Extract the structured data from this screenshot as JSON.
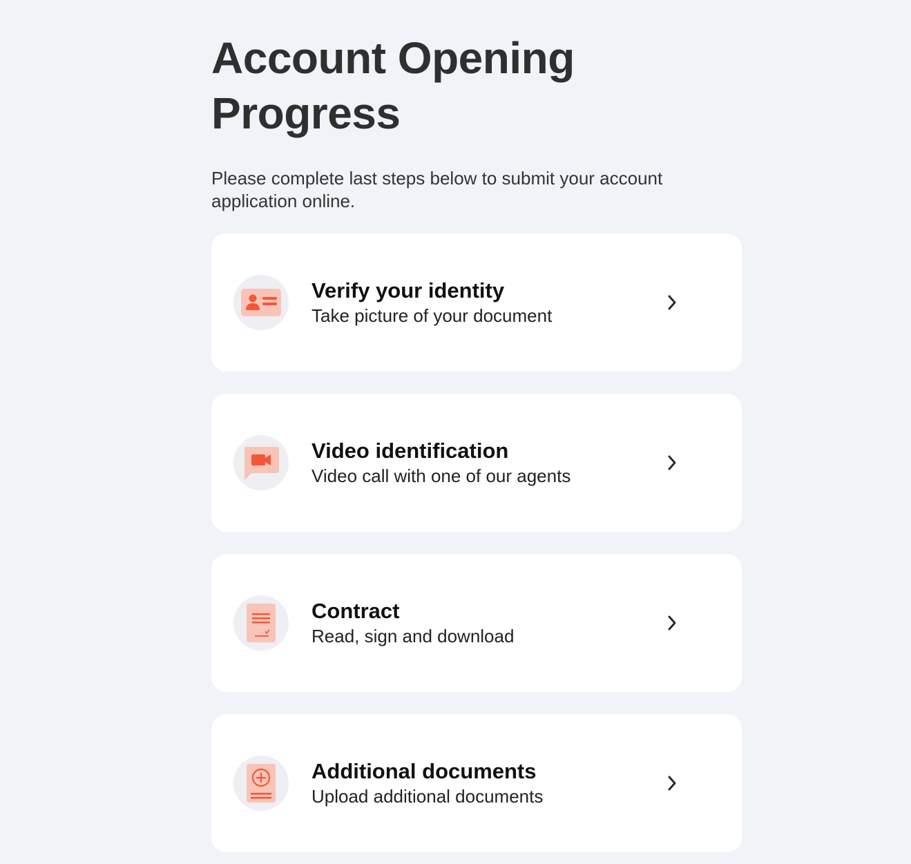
{
  "header": {
    "title": "Account Opening Progress",
    "subtitle": "Please complete last steps below to submit your account application online."
  },
  "colors": {
    "background": "#f0f3f8",
    "card": "#ffffff",
    "accent": "#f4563a",
    "accent_light": "#f8c4b8",
    "icon_circle": "#eeeef3"
  },
  "steps": [
    {
      "title": "Verify your identity",
      "description": "Take picture of your document",
      "icon": "id-card-icon"
    },
    {
      "title": "Video identification",
      "description": "Video call with one of our agents",
      "icon": "video-camera-icon"
    },
    {
      "title": "Contract",
      "description": "Read, sign and download",
      "icon": "contract-icon"
    },
    {
      "title": "Additional documents",
      "description": "Upload additional documents",
      "icon": "add-document-icon"
    }
  ]
}
